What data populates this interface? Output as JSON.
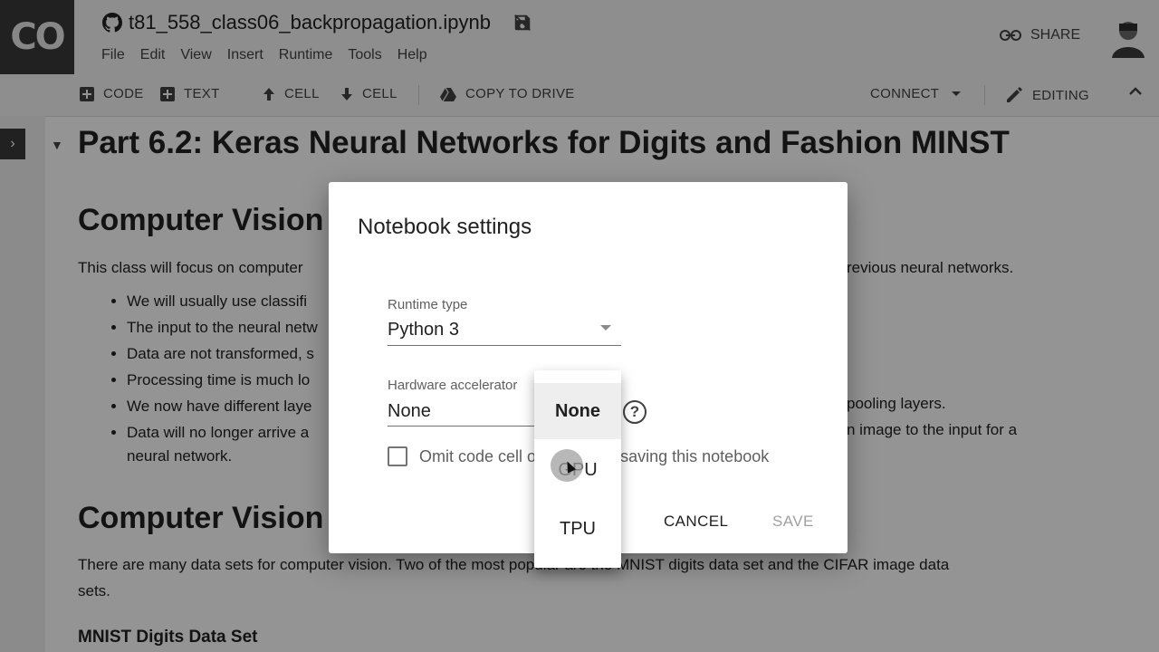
{
  "header": {
    "logo": "CO",
    "notebook_title": "t81_558_class06_backpropagation.ipynb",
    "menu": [
      "File",
      "Edit",
      "View",
      "Insert",
      "Runtime",
      "Tools",
      "Help"
    ],
    "share_label": "SHARE"
  },
  "toolbar": {
    "code_label": "CODE",
    "text_label": "TEXT",
    "cell_up_label": "CELL",
    "cell_down_label": "CELL",
    "copy_to_drive_label": "COPY TO DRIVE",
    "connect_label": "CONNECT",
    "editing_label": "EDITING"
  },
  "notebook": {
    "heading": "Part 6.2: Keras Neural Networks for Digits and Fashion MINST",
    "section1_heading": "Computer Vision",
    "section1_intro_left": "This class will focus on computer",
    "section1_intro_right": "revious neural networks.",
    "bullets": [
      "We will usually use classifi",
      "The input to the neural netw",
      "Data are not transformed, s",
      "Processing time is much lo",
      "We now have different laye",
      "Data will no longer arrive a"
    ],
    "bullet5_right": "pooling layers.",
    "bullet6_right": "n image to the input for a",
    "bullet6_cont": "neural network.",
    "section2_heading": "Computer Vision",
    "section2_text_1": "There are many data sets for computer vision. Two of the most popular are the MNIST digits data set and the CIFAR image data",
    "section2_text_2": "sets.",
    "section3_heading": "MNIST Digits Data Set"
  },
  "dialog": {
    "title": "Notebook settings",
    "runtime_label": "Runtime type",
    "runtime_value": "Python 3",
    "hardware_label": "Hardware accelerator",
    "hardware_value": "None",
    "help_glyph": "?",
    "omit_label": "Omit code cell output when saving this notebook",
    "cancel_label": "CANCEL",
    "save_label": "SAVE"
  },
  "dropdown": {
    "options": [
      "None",
      "GPU",
      "TPU"
    ],
    "selected": "None"
  }
}
